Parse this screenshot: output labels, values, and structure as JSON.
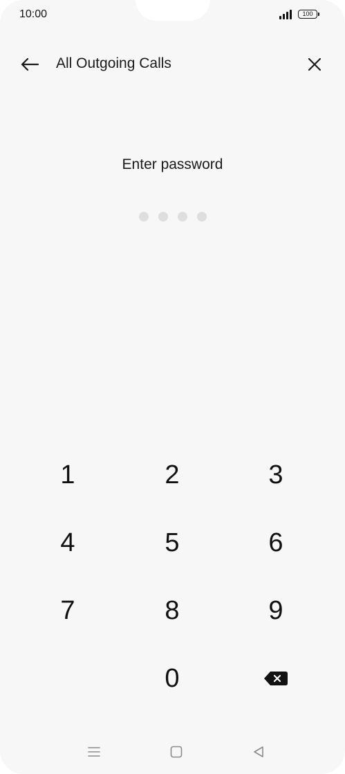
{
  "status_bar": {
    "time": "10:00",
    "battery": "100",
    "icons": [
      "signal-icon",
      "battery-icon"
    ]
  },
  "header": {
    "title": "All Outgoing Calls",
    "back_icon": "arrow-left-icon",
    "close_icon": "close-icon"
  },
  "prompt": {
    "text": "Enter password",
    "pin_length": 4,
    "entered": 0
  },
  "keypad": {
    "keys": [
      "1",
      "2",
      "3",
      "4",
      "5",
      "6",
      "7",
      "8",
      "9",
      "0"
    ],
    "delete_icon": "backspace-icon"
  },
  "navbar": {
    "icons": [
      "menu-icon",
      "home-icon",
      "back-triangle-icon"
    ]
  },
  "colors": {
    "background": "#f7f7f7",
    "text": "#1a1a1a",
    "dot_empty": "#dedede",
    "nav_icon": "#8a8a8a"
  }
}
